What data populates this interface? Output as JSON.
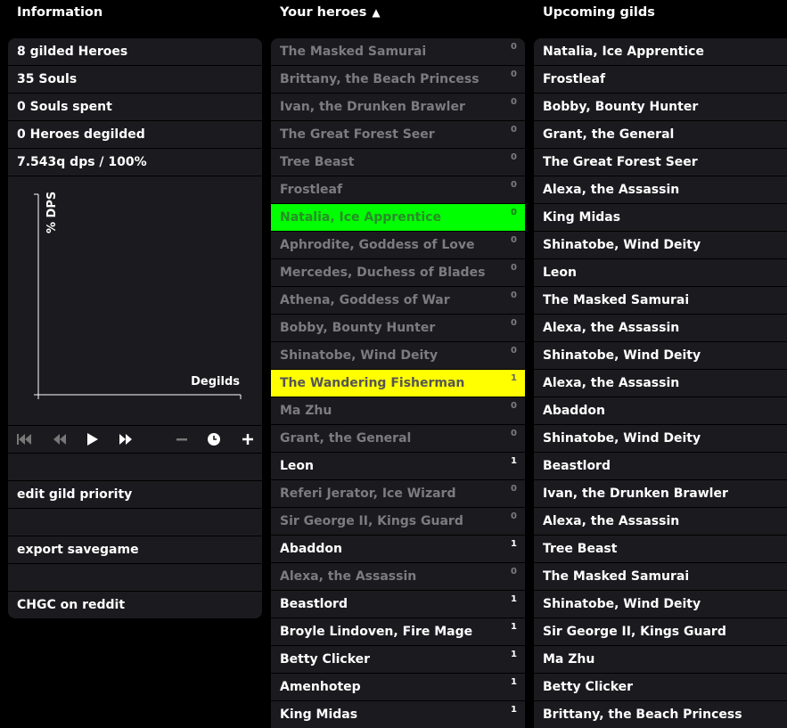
{
  "info": {
    "title": "Information",
    "stats": [
      "8 gilded Heroes",
      "35 Souls",
      "0 Souls spent",
      "0 Heroes degilded",
      "7.543q dps / 100%"
    ],
    "chart": {
      "ylabel": "% DPS",
      "xlabel": "Degilds"
    },
    "menu": [
      "",
      "edit gild priority",
      "",
      "export savegame",
      "",
      "CHGC on reddit"
    ]
  },
  "heroes": {
    "title": "Your heroes",
    "sort_arrow": "▲",
    "items": [
      {
        "name": "The Masked Samurai",
        "count": "0",
        "state": "dim"
      },
      {
        "name": "Brittany, the Beach Princess",
        "count": "0",
        "state": "dim"
      },
      {
        "name": "Ivan, the Drunken Brawler",
        "count": "0",
        "state": "dim"
      },
      {
        "name": "The Great Forest Seer",
        "count": "0",
        "state": "dim"
      },
      {
        "name": "Tree Beast",
        "count": "0",
        "state": "dim"
      },
      {
        "name": "Frostleaf",
        "count": "0",
        "state": "dim"
      },
      {
        "name": "Natalia, Ice Apprentice",
        "count": "0",
        "state": "green"
      },
      {
        "name": "Aphrodite, Goddess of Love",
        "count": "0",
        "state": "dim"
      },
      {
        "name": "Mercedes, Duchess of Blades",
        "count": "0",
        "state": "dim"
      },
      {
        "name": "Athena, Goddess of War",
        "count": "0",
        "state": "dim"
      },
      {
        "name": "Bobby, Bounty Hunter",
        "count": "0",
        "state": "dim"
      },
      {
        "name": "Shinatobe, Wind Deity",
        "count": "0",
        "state": "dim"
      },
      {
        "name": "The Wandering Fisherman",
        "count": "1",
        "state": "yellow"
      },
      {
        "name": "Ma Zhu",
        "count": "0",
        "state": "dim"
      },
      {
        "name": "Grant, the General",
        "count": "0",
        "state": "dim"
      },
      {
        "name": "Leon",
        "count": "1",
        "state": "bright"
      },
      {
        "name": "Referi Jerator, Ice Wizard",
        "count": "0",
        "state": "dim"
      },
      {
        "name": "Sir George II, Kings Guard",
        "count": "0",
        "state": "dim"
      },
      {
        "name": "Abaddon",
        "count": "1",
        "state": "bright"
      },
      {
        "name": "Alexa, the Assassin",
        "count": "0",
        "state": "dim"
      },
      {
        "name": "Beastlord",
        "count": "1",
        "state": "bright"
      },
      {
        "name": "Broyle Lindoven, Fire Mage",
        "count": "1",
        "state": "bright"
      },
      {
        "name": "Betty Clicker",
        "count": "1",
        "state": "bright"
      },
      {
        "name": "Amenhotep",
        "count": "1",
        "state": "bright"
      },
      {
        "name": "King Midas",
        "count": "1",
        "state": "bright"
      }
    ]
  },
  "upcoming": {
    "title": "Upcoming gilds",
    "items": [
      "Natalia, Ice Apprentice",
      "Frostleaf",
      "Bobby, Bounty Hunter",
      "Grant, the General",
      "The Great Forest Seer",
      "Alexa, the Assassin",
      "King Midas",
      "Shinatobe, Wind Deity",
      "Leon",
      "The Masked Samurai",
      "Alexa, the Assassin",
      "Shinatobe, Wind Deity",
      "Alexa, the Assassin",
      "Abaddon",
      "Shinatobe, Wind Deity",
      "Beastlord",
      "Ivan, the Drunken Brawler",
      "Alexa, the Assassin",
      "Tree Beast",
      "The Masked Samurai",
      "Shinatobe, Wind Deity",
      "Sir George II, Kings Guard",
      "Ma Zhu",
      "Betty Clicker",
      "Brittany, the Beach Princess"
    ]
  },
  "icons": {
    "controls": [
      "skip-back-icon",
      "rewind-icon",
      "play-icon",
      "fast-forward-icon",
      "minus-icon",
      "clock-icon",
      "plus-icon"
    ]
  }
}
